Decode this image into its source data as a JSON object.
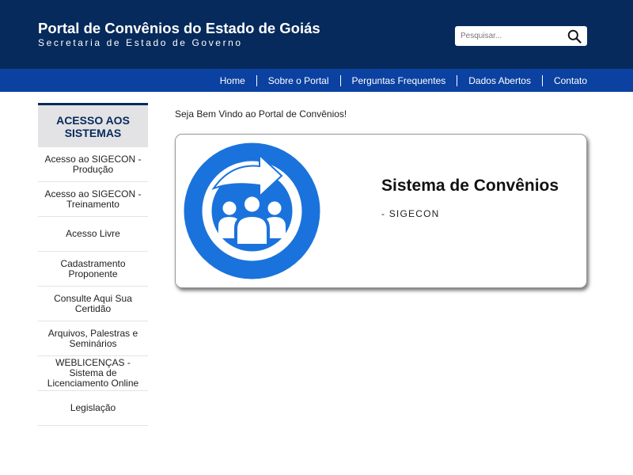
{
  "header": {
    "title": "Portal de Convênios do Estado de Goiás",
    "subtitle": "Secretaria de Estado de Governo",
    "bg_color": "#062a5b"
  },
  "search": {
    "placeholder": "Pesquisar...",
    "value": "",
    "icon": "search-icon"
  },
  "nav": {
    "bg_color": "#0b41a1",
    "items": [
      {
        "label": "Home"
      },
      {
        "label": "Sobre o Portal"
      },
      {
        "label": "Perguntas Frequentes"
      },
      {
        "label": "Dados Abertos"
      },
      {
        "label": "Contato"
      }
    ]
  },
  "sidebar": {
    "header": "ACESSO AOS SISTEMAS",
    "items": [
      {
        "label": "Acesso ao SIGECON - Produção"
      },
      {
        "label": "Acesso ao SIGECON - Treinamento"
      },
      {
        "label": "Acesso Livre"
      },
      {
        "label": "Cadastramento Proponente"
      },
      {
        "label": "Consulte Aqui Sua Certidão"
      },
      {
        "label": "Arquivos, Palestras e Seminários"
      },
      {
        "label": "WEBLICENÇAS - Sistema de Licenciamento Online"
      },
      {
        "label": "Legislação"
      }
    ]
  },
  "main": {
    "welcome": "Seja Bem Vindo ao Portal de Convênios!",
    "card": {
      "title": "Sistema de Convênios",
      "subtitle": "- SIGECON",
      "logo_icon": "people-refresh-icon",
      "logo_color": "#1a73dc"
    }
  }
}
